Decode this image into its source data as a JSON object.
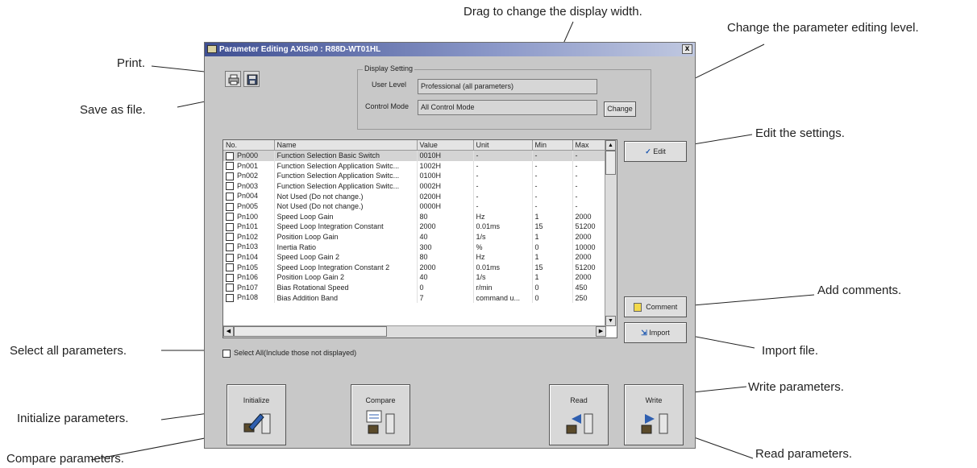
{
  "callouts": {
    "drag_width": "Drag to change the display width.",
    "change_level": "Change the parameter editing level.",
    "print": "Print.",
    "save_file": "Save as file.",
    "edit_settings": "Edit the settings.",
    "add_comments": "Add comments.",
    "select_all": "Select all parameters.",
    "import_file": "Import file.",
    "write_params": "Write parameters.",
    "init_params": "Initialize parameters.",
    "compare_params": "Compare parameters.",
    "read_params": "Read parameters."
  },
  "window": {
    "title": "Parameter Editing AXIS#0 : R88D-WT01HL",
    "close": "x"
  },
  "display_setting": {
    "legend": "Display Setting",
    "user_level_label": "User Level",
    "user_level_value": "Professional (all parameters)",
    "control_mode_label": "Control Mode",
    "control_mode_value": "All Control Mode",
    "change_label": "Change"
  },
  "table": {
    "headers": [
      "No.",
      "Name",
      "Value",
      "Unit",
      "Min",
      "Max"
    ],
    "rows": [
      [
        "Pn000",
        "Function Selection Basic Switch",
        "0010H",
        "-",
        "-",
        "-"
      ],
      [
        "Pn001",
        "Function Selection Application Switc...",
        "1002H",
        "-",
        "-",
        "-"
      ],
      [
        "Pn002",
        "Function Selection Application Switc...",
        "0100H",
        "-",
        "-",
        "-"
      ],
      [
        "Pn003",
        "Function Selection Application Switc...",
        "0002H",
        "-",
        "-",
        "-"
      ],
      [
        "Pn004",
        "Not Used (Do not change.)",
        "0200H",
        "-",
        "-",
        "-"
      ],
      [
        "Pn005",
        "Not Used (Do not change.)",
        "0000H",
        "-",
        "-",
        "-"
      ],
      [
        "Pn100",
        "Speed Loop Gain",
        "80",
        "Hz",
        "1",
        "2000"
      ],
      [
        "Pn101",
        "Speed Loop Integration Constant",
        "2000",
        "0.01ms",
        "15",
        "51200"
      ],
      [
        "Pn102",
        "Position Loop Gain",
        "40",
        "1/s",
        "1",
        "2000"
      ],
      [
        "Pn103",
        "Inertia Ratio",
        "300",
        "%",
        "0",
        "10000"
      ],
      [
        "Pn104",
        "Speed Loop Gain 2",
        "80",
        "Hz",
        "1",
        "2000"
      ],
      [
        "Pn105",
        "Speed Loop Integration Constant 2",
        "2000",
        "0.01ms",
        "15",
        "51200"
      ],
      [
        "Pn106",
        "Position Loop Gain 2",
        "40",
        "1/s",
        "1",
        "2000"
      ],
      [
        "Pn107",
        "Bias Rotational Speed",
        "0",
        "r/min",
        "0",
        "450"
      ],
      [
        "Pn108",
        "Bias Addition Band",
        "7",
        "command u...",
        "0",
        "250"
      ]
    ]
  },
  "buttons": {
    "edit": "Edit",
    "comment": "Comment",
    "import": "Import",
    "select_all": "Select All(Include those not displayed)",
    "initialize": "Initialize",
    "compare": "Compare",
    "read": "Read",
    "write": "Write"
  },
  "icons": [
    "printer-icon",
    "save-disk-icon",
    "checkmark-icon",
    "comment-note-icon",
    "import-icon",
    "initialize-icon",
    "compare-icon",
    "read-icon",
    "write-icon"
  ]
}
